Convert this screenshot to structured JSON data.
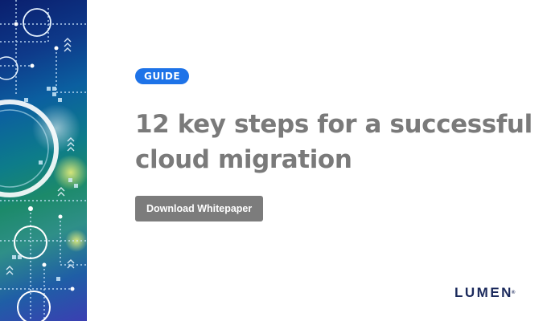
{
  "badge": {
    "label": "GUIDE"
  },
  "headline": {
    "line1": "12 key steps for a successful",
    "line2": "cloud migration"
  },
  "cta": {
    "label": "Download Whitepaper"
  },
  "brand": {
    "name": "LUMEN",
    "mark": "®"
  },
  "colors": {
    "badge_bg": "#1e73e8",
    "headline_text": "#7a7a7a",
    "cta_bg": "#7c7c7c",
    "logo_text": "#1b2a5c"
  },
  "icons": [
    "circuit-illustration"
  ]
}
